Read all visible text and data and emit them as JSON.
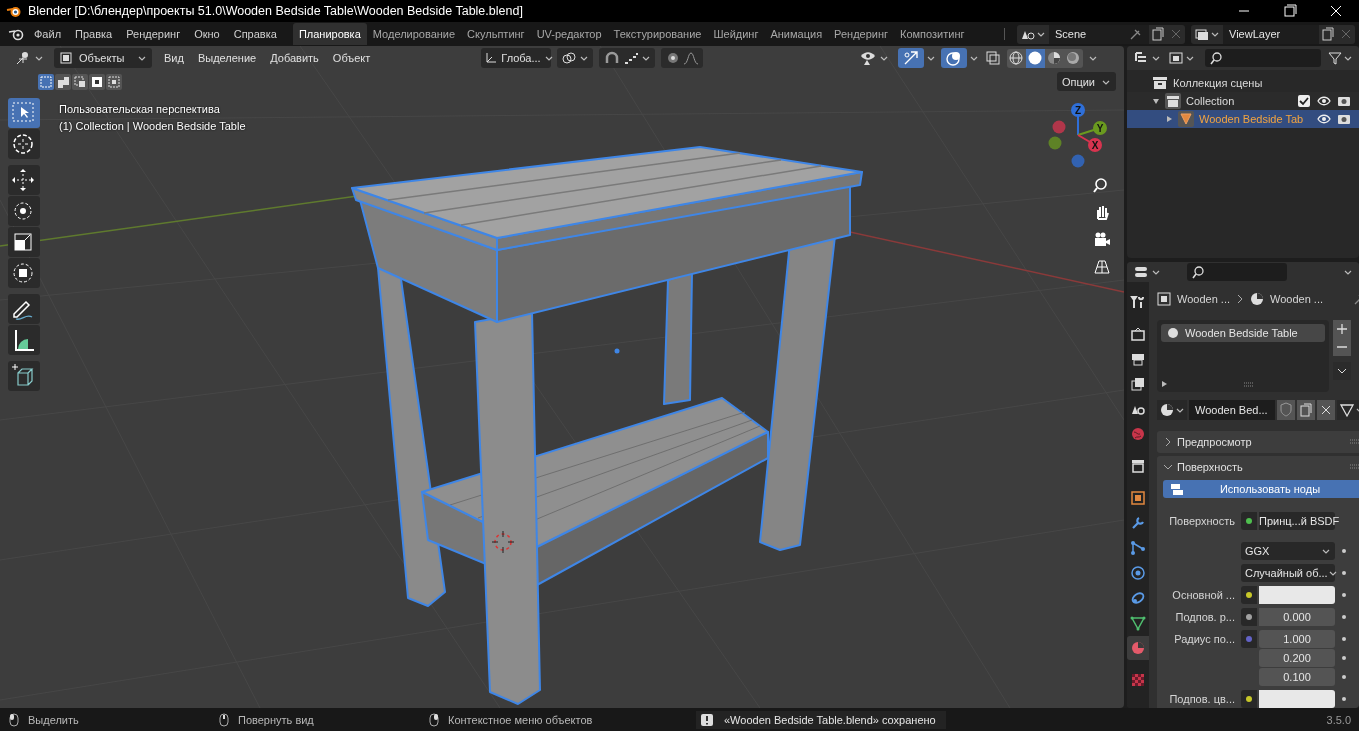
{
  "window": {
    "title": "Blender [D:\\блендер\\проекты 51.0\\Wooden Bedside Table\\Wooden Bedside Table.blend]"
  },
  "menu": [
    "Файл",
    "Правка",
    "Рендеринг",
    "Окно",
    "Справка"
  ],
  "workspaces": [
    {
      "label": "Планировка",
      "selected": true
    },
    {
      "label": "Моделирование",
      "selected": false
    },
    {
      "label": "Скульптинг",
      "selected": false
    },
    {
      "label": "UV-редактор",
      "selected": false
    },
    {
      "label": "Текстурирование",
      "selected": false
    },
    {
      "label": "Шейдинг",
      "selected": false
    },
    {
      "label": "Анимация",
      "selected": false
    },
    {
      "label": "Рендеринг",
      "selected": false
    },
    {
      "label": "Композитинг",
      "selected": false
    }
  ],
  "scene": {
    "name": "Scene"
  },
  "view_layer": {
    "name": "ViewLayer"
  },
  "viewport": {
    "mode": "Объекты",
    "menu": [
      "Вид",
      "Выделение",
      "Добавить",
      "Объект"
    ],
    "orientation": "Глоба...",
    "options": "Опции",
    "info": [
      "Пользовательская перспектива",
      "(1) Collection | Wooden Bedside Table"
    ],
    "select_modes": [
      {
        "selected": true
      },
      {
        "selected": false
      },
      {
        "selected": false
      },
      {
        "selected": false
      },
      {
        "selected": false
      }
    ],
    "tools": [
      {
        "kind": "select",
        "selected": true
      },
      {
        "kind": "cursor",
        "selected": false
      },
      {
        "kind": "move",
        "selected": false
      },
      {
        "kind": "rotate",
        "selected": false
      },
      {
        "kind": "scale",
        "selected": false
      },
      {
        "kind": "transform",
        "selected": false
      },
      {
        "kind": "annotate",
        "selected": false
      },
      {
        "kind": "measure",
        "selected": false
      },
      {
        "kind": "add_cube",
        "selected": false
      }
    ],
    "gizmos_on": true,
    "overlays_on": true,
    "shading": [
      {
        "kind": "wireframe",
        "selected": false
      },
      {
        "kind": "solid",
        "selected": true
      },
      {
        "kind": "material",
        "selected": false
      },
      {
        "kind": "rendered",
        "selected": false
      }
    ],
    "gizmo_axes": [
      {
        "label": "Z",
        "color": "#2f6fd8"
      },
      {
        "label": "Y",
        "color": "#6a9a1f"
      },
      {
        "label": "X",
        "color": "#d8344f"
      }
    ]
  },
  "outliner": {
    "items": [
      {
        "kind": "scene_collection",
        "label": "Коллекция сцены",
        "children": [
          {
            "kind": "collection",
            "label": "Collection",
            "expanded": true,
            "checked": true,
            "children": [
              {
                "kind": "mesh",
                "label": "Wooden Bedside Tab",
                "expanded": false,
                "selected": true
              }
            ]
          }
        ]
      }
    ]
  },
  "properties": {
    "tabs": [
      {
        "kind": "tool",
        "selected": false
      },
      {
        "kind": "render",
        "selected": false
      },
      {
        "kind": "output",
        "selected": false
      },
      {
        "kind": "view_layer",
        "selected": false
      },
      {
        "kind": "scene",
        "selected": false
      },
      {
        "kind": "world",
        "selected": false
      },
      {
        "kind": "collection",
        "selected": false
      },
      {
        "kind": "object",
        "selected": false
      },
      {
        "kind": "modifiers",
        "selected": false
      },
      {
        "kind": "particles",
        "selected": false
      },
      {
        "kind": "physics",
        "selected": false
      },
      {
        "kind": "constraints",
        "selected": false
      },
      {
        "kind": "data",
        "selected": false
      },
      {
        "kind": "material",
        "selected": true
      },
      {
        "kind": "texture",
        "selected": false
      }
    ],
    "breadcrumb": [
      "Wooden ...",
      "Wooden ..."
    ],
    "material_slots": [
      {
        "label": "Wooden Bedside Table",
        "selected": true
      }
    ],
    "material_name": "Wooden Bed...",
    "panels": [
      {
        "label": "Предпросмотр",
        "expanded": false
      },
      {
        "label": "Поверхность",
        "expanded": true
      }
    ],
    "use_nodes": "Использовать ноды",
    "fields": [
      {
        "kind": "link",
        "label": "Поверхность",
        "value": "Принц...й BSDF",
        "color": "#4fbf4f"
      },
      {
        "kind": "dropdown",
        "value": "GGX"
      },
      {
        "kind": "dropdown",
        "value": "Случайный об..."
      },
      {
        "kind": "color",
        "label": "Основной ...",
        "color": "#c7c729"
      },
      {
        "kind": "number",
        "label": "Подпов. р...",
        "value": "0.000",
        "color": "#a1a1a1"
      },
      {
        "kind": "vector",
        "label": "Радиус по...",
        "values": [
          "1.000",
          "0.200",
          "0.100"
        ],
        "color": "#6363c7"
      },
      {
        "kind": "color",
        "label": "Подпов. цв...",
        "color": "#c7c729"
      }
    ]
  },
  "status_bar": {
    "hints": [
      "Выделить",
      "Повернуть вид",
      "Контекстное меню объектов"
    ],
    "message": "«Wooden Bedside Table.blend» сохранено",
    "version": "3.5.0"
  }
}
